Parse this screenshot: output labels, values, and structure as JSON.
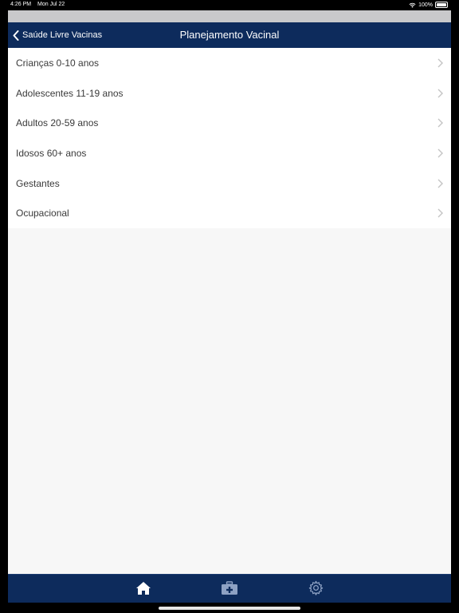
{
  "status_bar": {
    "time": "4:26 PM",
    "date": "Mon Jul 22",
    "battery": "100%",
    "wifi_icon": "wifi-icon"
  },
  "nav": {
    "back_label": "Saúde Livre Vacinas",
    "title": "Planejamento Vacinal",
    "back_icon": "chevron-left-icon"
  },
  "menu": {
    "items": [
      {
        "label": "Crianças 0-10 anos"
      },
      {
        "label": "Adolescentes 11-19 anos"
      },
      {
        "label": "Adultos 20-59 anos"
      },
      {
        "label": "Idosos 60+ anos"
      },
      {
        "label": "Gestantes"
      },
      {
        "label": "Ocupacional"
      }
    ]
  },
  "tabs": [
    {
      "icon": "home-icon",
      "selected": true
    },
    {
      "icon": "medical-kit-icon",
      "selected": false
    },
    {
      "icon": "gear-icon",
      "selected": false
    }
  ],
  "colors": {
    "nav_background": "#0d2b5c",
    "list_background": "#ffffff",
    "page_background": "#f7f7f7",
    "chevron": "#c4c4c4"
  }
}
